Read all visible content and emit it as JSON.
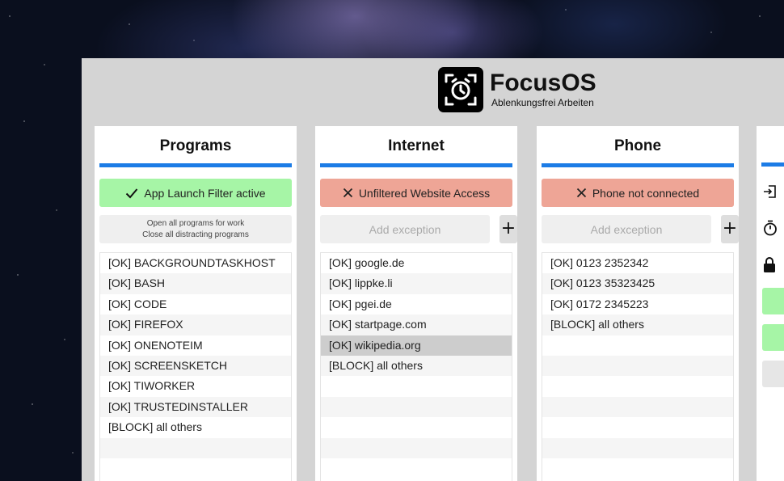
{
  "brand": {
    "title": "FocusOS",
    "subtitle": "Ablenkungsfrei Arbeiten"
  },
  "programs": {
    "title": "Programs",
    "status": "App Launch Filter active",
    "status_kind": "ok",
    "hint_line1": "Open all programs for work",
    "hint_line2": "Close all distracting programs",
    "items": [
      "[OK] BACKGROUNDTASKHOST",
      "[OK] BASH",
      "[OK] CODE",
      "[OK] FIREFOX",
      "[OK] ONENOTEIM",
      "[OK] SCREENSKETCH",
      "[OK] TIWORKER",
      "[OK] TRUSTEDINSTALLER",
      "[BLOCK] all others"
    ]
  },
  "internet": {
    "title": "Internet",
    "status": "Unfiltered Website Access",
    "status_kind": "bad",
    "add_placeholder": "Add exception",
    "add_label": "+",
    "items": [
      "[OK] google.de",
      "[OK] lippke.li",
      "[OK] pgei.de",
      "[OK] startpage.com",
      "[OK] wikipedia.org",
      "[BLOCK] all others"
    ],
    "selected_index": 4
  },
  "phone": {
    "title": "Phone",
    "status": "Phone not connected",
    "status_kind": "bad",
    "add_placeholder": "Add exception",
    "add_label": "+",
    "items": [
      "[OK] 0123 2352342",
      "[OK] 0123 35323425",
      "[OK] 0172 2345223",
      "[BLOCK] all others"
    ]
  },
  "side": {
    "icons": [
      "sign-in-icon",
      "stopwatch-icon",
      "lock-icon"
    ],
    "button_colors": [
      "#a6f5a6",
      "#a6f5a6",
      "#e6e6e6"
    ]
  },
  "colors": {
    "accent": "#1c7ce6",
    "ok": "#a6f5a6",
    "bad": "#eea596",
    "app_bg": "#d4d4d4"
  }
}
